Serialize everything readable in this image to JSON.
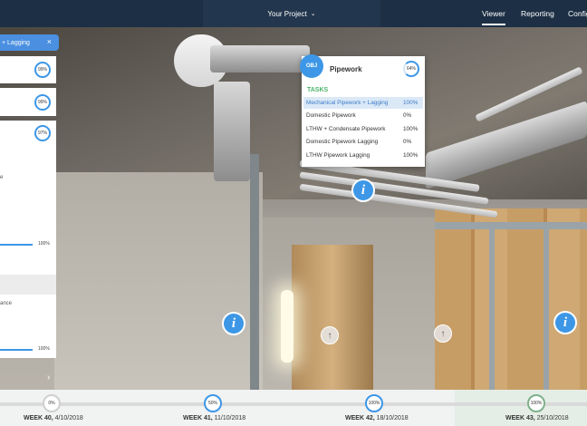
{
  "topbar": {
    "project": "Your Project",
    "tabs": [
      {
        "label": "Viewer",
        "active": true
      },
      {
        "label": "Reporting",
        "active": false
      },
      {
        "label": "Config",
        "active": false
      }
    ]
  },
  "left_panel": {
    "chip_label": "+ Lagging",
    "card_percents": [
      "99%",
      "99%",
      "97%"
    ],
    "text_fragments": [
      "e",
      "ance"
    ],
    "bar_labels": [
      "100%",
      "100%"
    ]
  },
  "popup": {
    "badge": "OBJ",
    "title": "Pipework",
    "overall": "64%",
    "overall_fraction": 0.64,
    "tasks_heading": "TASKS",
    "tasks": [
      {
        "name": "Mechanical Pipework + Lagging",
        "pct": "100%",
        "selected": true
      },
      {
        "name": "Domestic Pipework",
        "pct": "0%",
        "selected": false
      },
      {
        "name": "LTHW + Condensate Pipework",
        "pct": "100%",
        "selected": false
      },
      {
        "name": "Domestic Pipework Lagging",
        "pct": "0%",
        "selected": false
      },
      {
        "name": "LTHW Pipework Lagging",
        "pct": "100%",
        "selected": false
      }
    ]
  },
  "markers": {
    "info_glyph": "i",
    "arrow_glyph": "↑",
    "chevron": "›"
  },
  "timeline": {
    "weeks": [
      {
        "week": "WEEK 40,",
        "date": "4/10/2018",
        "pct": "0%",
        "active": false
      },
      {
        "week": "WEEK 41,",
        "date": "11/10/2018",
        "pct": "50%",
        "active": false
      },
      {
        "week": "WEEK 42,",
        "date": "18/10/2018",
        "pct": "100%",
        "active": false
      },
      {
        "week": "WEEK 43,",
        "date": "25/10/2018",
        "pct": "100%",
        "active": true
      }
    ]
  },
  "colors": {
    "accent": "#3d97e6",
    "topbar": "#1c2f44",
    "tasks_heading": "#49b36a",
    "active_week_ring": "#7fb08a"
  }
}
